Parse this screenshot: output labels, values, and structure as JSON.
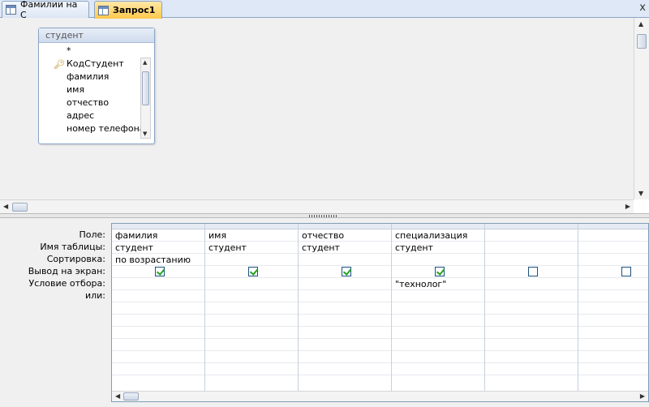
{
  "tabs": [
    {
      "label": "Фамилии на С",
      "active": false
    },
    {
      "label": "Запрос1",
      "active": true
    }
  ],
  "close_glyph": "x",
  "table_box": {
    "title": "студент",
    "fields": [
      "*",
      "КодСтудент",
      "фамилия",
      "имя",
      "отчество",
      "адрес",
      "номер телефона"
    ],
    "key_field_index": 1
  },
  "row_labels": [
    "Поле:",
    "Имя таблицы:",
    "Сортировка:",
    "Вывод на экран:",
    "Условие отбора:",
    "или:"
  ],
  "columns": [
    {
      "field": "фамилия",
      "table": "студент",
      "sort": "по возрастанию",
      "show": true,
      "criteria": "",
      "or": ""
    },
    {
      "field": "имя",
      "table": "студент",
      "sort": "",
      "show": true,
      "criteria": "",
      "or": ""
    },
    {
      "field": "отчество",
      "table": "студент",
      "sort": "",
      "show": true,
      "criteria": "",
      "or": ""
    },
    {
      "field": "специализация",
      "table": "студент",
      "sort": "",
      "show": true,
      "criteria": "\"технолог\"",
      "or": ""
    },
    {
      "field": "",
      "table": "",
      "sort": "",
      "show": false,
      "criteria": "",
      "or": ""
    },
    {
      "field": "",
      "table": "",
      "sort": "",
      "show": false,
      "criteria": "",
      "or": ""
    }
  ]
}
